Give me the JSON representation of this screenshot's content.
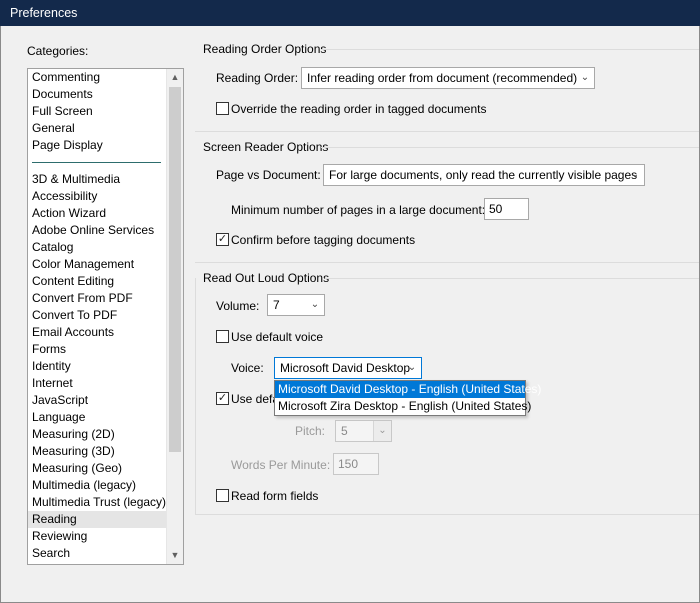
{
  "window": {
    "title": "Preferences"
  },
  "categories": {
    "label": "Categories:",
    "top_items": [
      "Commenting",
      "Documents",
      "Full Screen",
      "General",
      "Page Display"
    ],
    "items": [
      "3D & Multimedia",
      "Accessibility",
      "Action Wizard",
      "Adobe Online Services",
      "Catalog",
      "Color Management",
      "Content Editing",
      "Convert From PDF",
      "Convert To PDF",
      "Email Accounts",
      "Forms",
      "Identity",
      "Internet",
      "JavaScript",
      "Language",
      "Measuring (2D)",
      "Measuring (3D)",
      "Measuring (Geo)",
      "Multimedia (legacy)",
      "Multimedia Trust (legacy)",
      "Reading",
      "Reviewing",
      "Search"
    ],
    "selected": "Reading"
  },
  "reading_order": {
    "group_title": "Reading Order Options",
    "order_label": "Reading Order:",
    "order_value": "Infer reading order from document (recommended)",
    "override_label": "Override the reading order in tagged documents",
    "override_checked": false
  },
  "screen_reader": {
    "group_title": "Screen Reader Options",
    "page_vs_doc_label": "Page vs Document:",
    "page_vs_doc_value": "For large documents, only read the currently visible pages",
    "min_pages_label": "Minimum number of pages in a large document:",
    "min_pages_value": "50",
    "confirm_label": "Confirm before tagging documents",
    "confirm_checked": true
  },
  "read_out_loud": {
    "group_title": "Read Out Loud Options",
    "volume_label": "Volume:",
    "volume_value": "7",
    "default_voice_label": "Use default voice",
    "default_voice_checked": false,
    "voice_label": "Voice:",
    "voice_value": "Microsoft David Desktop",
    "voice_options": [
      "Microsoft David Desktop - English (United States)",
      "Microsoft Zira Desktop - English (United States)"
    ],
    "default_speech_label": "Use defa",
    "default_speech_checked": true,
    "pitch_label": "Pitch:",
    "pitch_value": "5",
    "wpm_label": "Words Per Minute:",
    "wpm_value": "150",
    "form_fields_label": "Read form fields",
    "form_fields_checked": false
  },
  "colors": {
    "titlebar": "#13294b",
    "accent": "#0078d7"
  }
}
